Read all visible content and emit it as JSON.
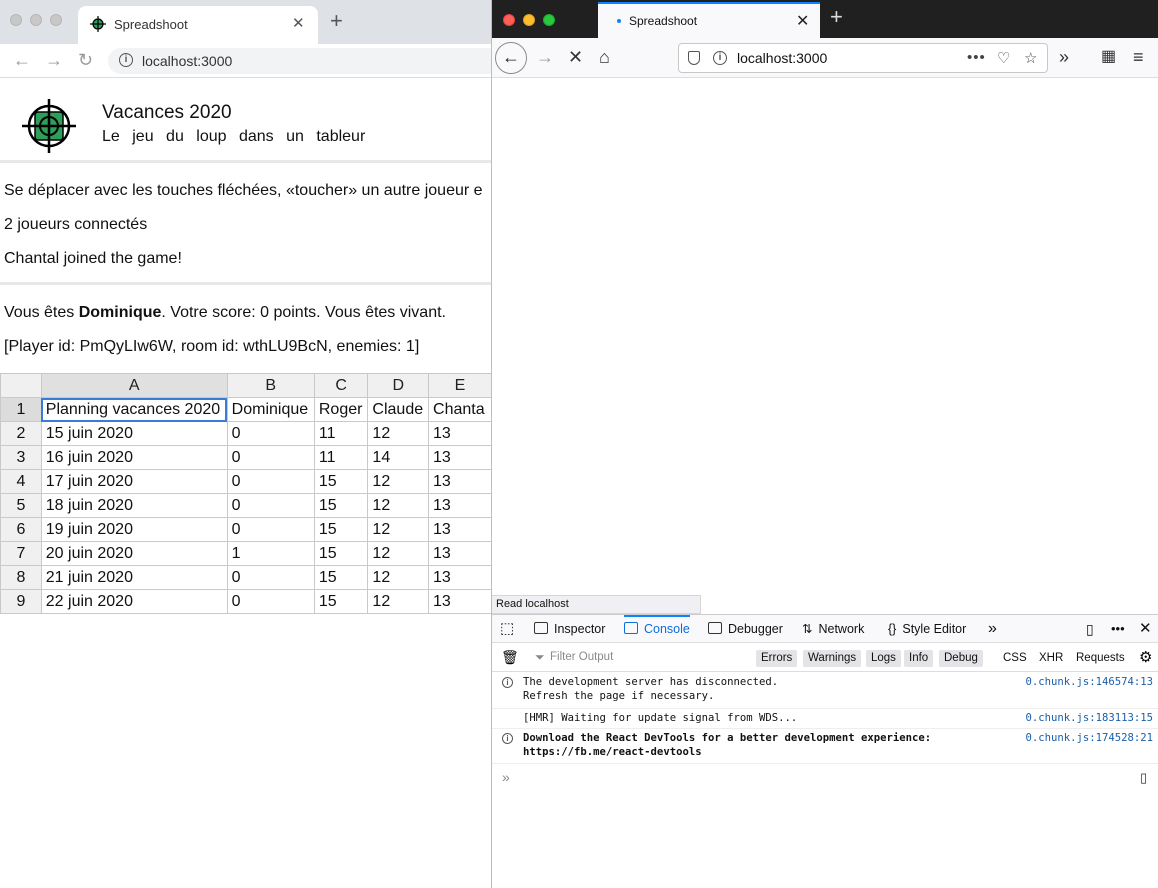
{
  "chrome": {
    "tab_title": "Spreadshoot",
    "tab_close": "✕",
    "new_tab": "+",
    "url": "localhost:3000"
  },
  "app": {
    "title": "Vacances 2020",
    "subtitle": "Le jeu du loup dans un tableur",
    "instructions": "Se déplacer avec les touches fléchées, «toucher» un autre joueur e",
    "players_connected": "2 joueurs connectés",
    "event": "Chantal joined the game!",
    "status_prefix": "Vous êtes ",
    "player_name": "Dominique",
    "status_suffix": ". Votre score: 0 points. Vous êtes vivant.",
    "debug": "[Player id: PmQyLIw6W, room id: wthLU9BcN, enemies: 1]"
  },
  "sheet": {
    "columns": [
      "A",
      "B",
      "C",
      "D",
      "E"
    ],
    "rows": [
      {
        "n": "1",
        "cells": [
          "Planning vacances 2020",
          "Dominique",
          "Roger",
          "Claude",
          "Chanta"
        ]
      },
      {
        "n": "2",
        "cells": [
          "15 juin 2020",
          "0",
          "11",
          "12",
          "13"
        ]
      },
      {
        "n": "3",
        "cells": [
          "16 juin 2020",
          "0",
          "11",
          "14",
          "13"
        ]
      },
      {
        "n": "4",
        "cells": [
          "17 juin 2020",
          "0",
          "15",
          "12",
          "13"
        ]
      },
      {
        "n": "5",
        "cells": [
          "18 juin 2020",
          "0",
          "15",
          "12",
          "13"
        ]
      },
      {
        "n": "6",
        "cells": [
          "19 juin 2020",
          "0",
          "15",
          "12",
          "13"
        ]
      },
      {
        "n": "7",
        "cells": [
          "20 juin 2020",
          "1",
          "15",
          "12",
          "13"
        ]
      },
      {
        "n": "8",
        "cells": [
          "21 juin 2020",
          "0",
          "15",
          "12",
          "13"
        ]
      },
      {
        "n": "9",
        "cells": [
          "22 juin 2020",
          "0",
          "15",
          "12",
          "13"
        ]
      }
    ]
  },
  "firefox": {
    "tab_title": "Spreadshoot",
    "tab_close": "✕",
    "new_tab": "+",
    "url": "localhost:3000",
    "status_tooltip": "Read localhost",
    "devtools": {
      "tabs": [
        "Inspector",
        "Console",
        "Debugger",
        "Network",
        "Style Editor"
      ],
      "active_tab": "Console",
      "filter_placeholder": "Filter Output",
      "levels": [
        "Errors",
        "Warnings",
        "Logs",
        "Info",
        "Debug"
      ],
      "extra_filters": [
        "CSS",
        "XHR",
        "Requests"
      ],
      "messages": [
        {
          "text": "The development server has disconnected.\nRefresh the page if necessary.",
          "source": "0.chunk.js:146574:13",
          "icon": "info-icon"
        },
        {
          "text": "[HMR] Waiting for update signal from WDS...",
          "source": "0.chunk.js:183113:15",
          "icon": ""
        },
        {
          "text": "Download the React DevTools for a better development experience:\nhttps://fb.me/react-devtools",
          "source": "0.chunk.js:174528:21",
          "icon": "info-icon"
        }
      ],
      "prompt": "»"
    }
  },
  "colors": {
    "accent_blue": "#0a84ff",
    "selection_blue": "#3a7bd5",
    "logo_green": "#2e9e5b"
  }
}
